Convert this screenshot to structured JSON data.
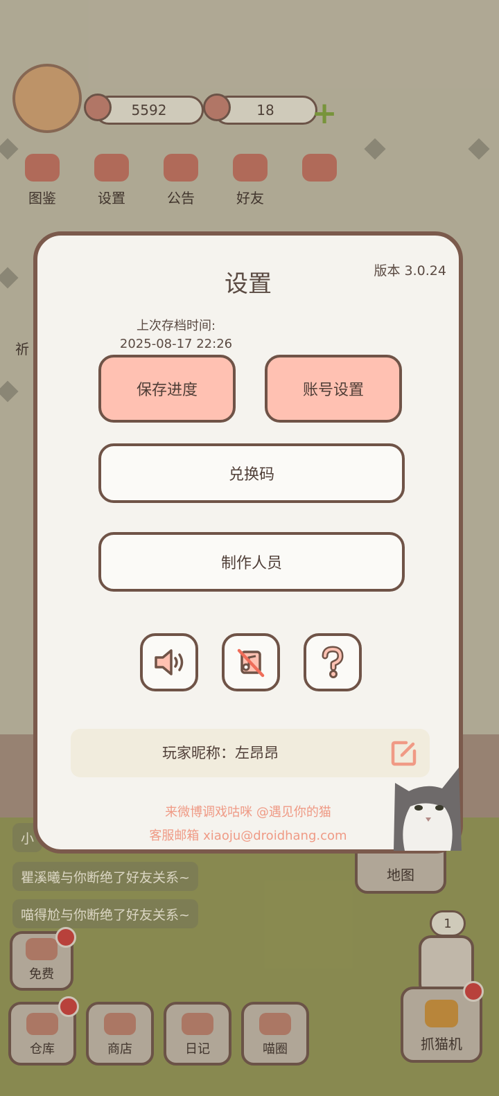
{
  "hud": {
    "coins": "5592",
    "hearts": "18",
    "top_menu": [
      "图鉴",
      "设置",
      "公告",
      "好友"
    ]
  },
  "chat": {
    "partial_line": "小",
    "messages": [
      "瞿溪曦与你断绝了好友关系~",
      "喵得尬与你断绝了好友关系~"
    ]
  },
  "side_hints": {
    "left_partial": "祈"
  },
  "bottom_bar": {
    "free": "免费",
    "items": [
      "仓库",
      "商店",
      "日记",
      "喵圈"
    ],
    "map": "地图",
    "machine_count": "1",
    "claw_machine": "抓猫机"
  },
  "settings": {
    "title": "设置",
    "version": "版本 3.0.24",
    "last_save_label": "上次存档时间:",
    "last_save_time": "2025-08-17 22:26",
    "save_button": "保存进度",
    "account_button": "账号设置",
    "redeem_button": "兑换码",
    "credits_button": "制作人员",
    "icons": [
      "sound-icon",
      "music-off-icon",
      "help-icon"
    ],
    "nickname_label": "玩家昵称：",
    "nickname": "左昂昂",
    "weibo_line": "来微博调戏咕咪 @遇见你的猫",
    "email_line": "客服邮箱 xiaoju@droidhang.com"
  },
  "colors": {
    "dialog_border": "#7b5a4c",
    "pink_button": "#ffc1b2",
    "link_text": "#ef9a85"
  }
}
